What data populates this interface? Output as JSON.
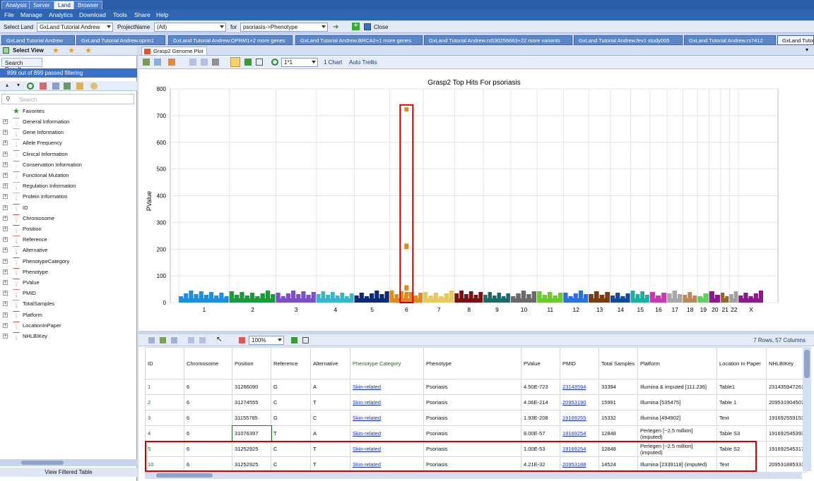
{
  "top_tabs": [
    "Analysis",
    "Server",
    "Land",
    "Browser"
  ],
  "menu": [
    "File",
    "Manage",
    "Analytics",
    "Download",
    "Tools",
    "Share",
    "Help"
  ],
  "toolbar": {
    "select_land_label": "Select Land",
    "land_value": "GxLand Tutorial Andrew",
    "project_label": "ProjectName",
    "project_value": "(All)",
    "for_label": "for",
    "for_value": "psoriasis->Phenotype",
    "close_label": "Close"
  },
  "doc_tabs": [
    "GxLand Tutorial Andrew",
    "GxLand Tutorial Andrew.oprm1",
    "GxLand Tutorial Andrew.OPRM1+2 more genes",
    "GxLand Tutorial Andrew.BRCA2+1 more genes",
    "GxLand Tutorial Andrew.rs530256683+22 more variants",
    "GxLand Tutorial Andrew.fev1 study005",
    "GxLand Tutorial Andrew.rs7412",
    "GxLand Tutori"
  ],
  "left": {
    "select_view": "Select View",
    "search_result_tab": "Search Result",
    "filter_status": "899 out of 899 passed filtering",
    "search_placeholder": "Search",
    "favorites": "Favorites",
    "items": [
      "General Information",
      "Gene Information",
      "Allele Frequency",
      "Clinical Information",
      "Conservation Information",
      "Functional Mutation",
      "Regulation Information",
      "Protein Information",
      "ID",
      "Chromosome",
      "Position",
      "Reference",
      "Alternative",
      "PhenotypeCategory",
      "Phenotype",
      "PValue",
      "PMID",
      "TotalSamples",
      "Platform",
      "LocationInPaper",
      "NHLBIKey"
    ],
    "view_filtered": "View Filtered Table"
  },
  "plot_tab": "Grasp2 Genome Plot",
  "plot_toolbar": {
    "trellis_value": "1*1",
    "one_chart": "1 Chart",
    "auto_trellis": "Auto Trellis"
  },
  "grid_toolbar": {
    "zoom": "100%",
    "rows_cols": "7 Rows, 57 Columns"
  },
  "chart_data": {
    "type": "scatter",
    "title": "Grasp2 Top Hits For psoriasis",
    "ylabel": "PValue",
    "ylim": [
      0,
      800
    ],
    "yticks": [
      0,
      100,
      200,
      300,
      400,
      500,
      600,
      700,
      800
    ],
    "categories": [
      "1",
      "2",
      "3",
      "4",
      "5",
      "6",
      "7",
      "8",
      "9",
      "10",
      "11",
      "12",
      "13",
      "14",
      "15",
      "16",
      "17",
      "18",
      "19",
      "20",
      "21",
      "22",
      "X"
    ],
    "highlight_points": [
      {
        "chromosome": "6",
        "value": 723
      },
      {
        "chromosome": "6",
        "value": 213
      },
      {
        "chromosome": "6",
        "value": 208
      },
      {
        "chromosome": "6",
        "value": 57
      },
      {
        "chromosome": "6",
        "value": 53
      },
      {
        "chromosome": "6",
        "value": 32
      }
    ],
    "colors": [
      "#1e8fe0",
      "#1c9a3a",
      "#7a4fc8",
      "#38b7c8",
      "#0d2a78",
      "#e2891c",
      "#e4c860",
      "#7a1212",
      "#1a6b68",
      "#6a6a6a",
      "#6ccb2a",
      "#2b6fe0",
      "#7a3b12",
      "#144a9a",
      "#1ab0a0",
      "#c63ab0",
      "#a8a8a8",
      "#b88a5a",
      "#60d060",
      "#8a1a8a",
      "#8a6a2a",
      "#a0a0a0",
      "#8a1a8a"
    ],
    "highlight_color": "#e2891c",
    "highlight_box_color": "#d40000"
  },
  "table": {
    "columns": [
      "ID",
      "Chromosome",
      "Position",
      "Reference",
      "Alternative",
      "Phenotype Category",
      "Phenotype",
      "PValue",
      "PMID",
      "Total Samples",
      "Platform",
      "Location In Paper",
      "NHLBIKey"
    ],
    "rows": [
      [
        "1",
        "6",
        "31266090",
        "G",
        "A",
        "Skin-related",
        "Psoriasis",
        "4.50E-723",
        "23143594",
        "33394",
        "Illumina & imputed [111.236]",
        "Table1",
        "231435947261"
      ],
      [
        "2",
        "6",
        "31274555",
        "C",
        "T",
        "Skin-related",
        "Psoriasis",
        "4.06E-214",
        "20953190",
        "15991",
        "Illumina [535475]",
        "Table 1",
        "209531904507"
      ],
      [
        "3",
        "6",
        "31155785",
        "G",
        "C",
        "Skin-related",
        "Psoriasis",
        "1.93E-208",
        "19169255",
        "15332",
        "Illumina [494902]",
        "Text",
        "191692559151"
      ],
      [
        "4",
        "6",
        "31076397",
        "T",
        "A",
        "Skin-related",
        "Psoriasis",
        "8.00E-57",
        "19169254",
        "12848",
        "Perlegen [~2.5 million] (imputed)",
        "Table S3",
        "191692545393"
      ],
      [
        "5",
        "6",
        "31252925",
        "C",
        "T",
        "Skin-related",
        "Psoriasis",
        "1.00E-53",
        "19169254",
        "12848",
        "Perlegen [~2.5 million] (imputed)",
        "Table S2",
        "191692545317"
      ],
      [
        "10",
        "6",
        "31252925",
        "C",
        "T",
        "Skin-related",
        "Psoriasis",
        "4.21E-32",
        "20953188",
        "14524",
        "Illumina [2339118] (imputed)",
        "Text",
        "209531885331"
      ]
    ]
  }
}
